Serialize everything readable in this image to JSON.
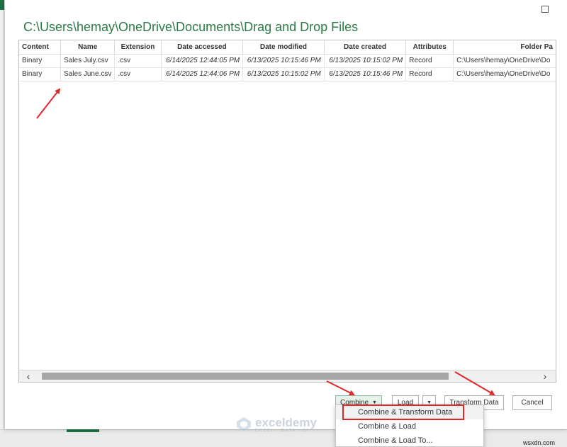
{
  "dialog": {
    "path_title": "C:\\Users\\hemay\\OneDrive\\Documents\\Drag and Drop Files"
  },
  "table": {
    "columns": [
      "Content",
      "Name",
      "Extension",
      "Date accessed",
      "Date modified",
      "Date created",
      "Attributes",
      "Folder Pa"
    ],
    "rows": [
      [
        "Binary",
        "Sales July.csv",
        ".csv",
        "6/14/2025 12:44:05 PM",
        "6/13/2025 10:15:46 PM",
        "6/13/2025 10:15:02 PM",
        "Record",
        "C:\\Users\\hemay\\OneDrive\\Do"
      ],
      [
        "Binary",
        "Sales June.csv",
        ".csv",
        "6/14/2025 12:44:06 PM",
        "6/13/2025 10:15:02 PM",
        "6/13/2025 10:15:46 PM",
        "Record",
        "C:\\Users\\hemay\\OneDrive\\Do"
      ]
    ]
  },
  "buttons": {
    "combine": "Combine",
    "load": "Load",
    "transform": "Transform Data",
    "cancel": "Cancel"
  },
  "combine_menu": [
    "Combine & Transform Data",
    "Combine & Load",
    "Combine & Load To..."
  ],
  "watermark": {
    "name": "exceldemy",
    "tagline": "EXCEL · DATA · BI"
  },
  "site_mark": "wsxdn.com",
  "colors": {
    "title_green": "#2b7a45",
    "annotation_red": "#e0252b",
    "combine_bg": "#e6f2ea"
  },
  "icons": {
    "maximize": "maximize-icon",
    "scroll_left": "chevron-left-icon",
    "scroll_right": "chevron-right-icon",
    "dropdown": "caret-down-icon"
  }
}
